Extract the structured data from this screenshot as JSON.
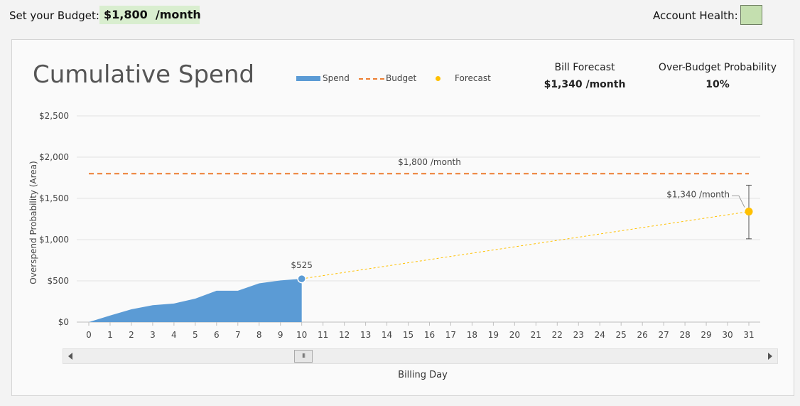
{
  "header": {
    "budget_label": "Set your Budget:",
    "budget_value": "$1,800  /month",
    "health_label": "Account Health:",
    "health_color": "#c4dfaf"
  },
  "panel": {
    "title": "Cumulative Spend",
    "legend": {
      "spend": "Spend",
      "budget": "Budget",
      "forecast": "Forecast"
    },
    "bill_forecast": {
      "label": "Bill Forecast",
      "value": "$1,340 /month"
    },
    "over_budget": {
      "label": "Over-Budget Probability",
      "value": "10%"
    },
    "scrollbar": {
      "thumb_glyph": "III"
    }
  },
  "chart_data": {
    "type": "area",
    "title": "Cumulative Spend",
    "xlabel": "Billing Day",
    "ylabel": "Overspend Probability (Area)",
    "xlim": [
      0,
      31
    ],
    "ylim": [
      0,
      2500
    ],
    "yticks": [
      0,
      500,
      1000,
      1500,
      2000,
      2500
    ],
    "ytick_labels": [
      "$0",
      "$500",
      "$1,000",
      "$1,500",
      "$2,000",
      "$2,500"
    ],
    "xticks": [
      0,
      1,
      2,
      3,
      4,
      5,
      6,
      7,
      8,
      9,
      10,
      11,
      12,
      13,
      14,
      15,
      16,
      17,
      18,
      19,
      20,
      21,
      22,
      23,
      24,
      25,
      26,
      27,
      28,
      29,
      30,
      31
    ],
    "grid": true,
    "legend_position": "top",
    "colors": {
      "spend": "#5b9bd5",
      "budget": "#ed7d31",
      "forecast": "#ffc000"
    },
    "series": [
      {
        "name": "Spend",
        "type": "area",
        "x": [
          0,
          1,
          2,
          3,
          4,
          5,
          6,
          7,
          8,
          9,
          10
        ],
        "y": [
          0,
          80,
          155,
          205,
          225,
          285,
          380,
          380,
          470,
          505,
          525
        ],
        "end_label": "$525"
      },
      {
        "name": "Budget",
        "type": "line",
        "y": 1800,
        "label": "$1,800 /month"
      },
      {
        "name": "Forecast",
        "type": "line",
        "x": [
          10,
          31
        ],
        "y": [
          525,
          1340
        ],
        "error_bar": [
          1010,
          1660
        ],
        "end_label": "$1,340 /month"
      }
    ]
  }
}
